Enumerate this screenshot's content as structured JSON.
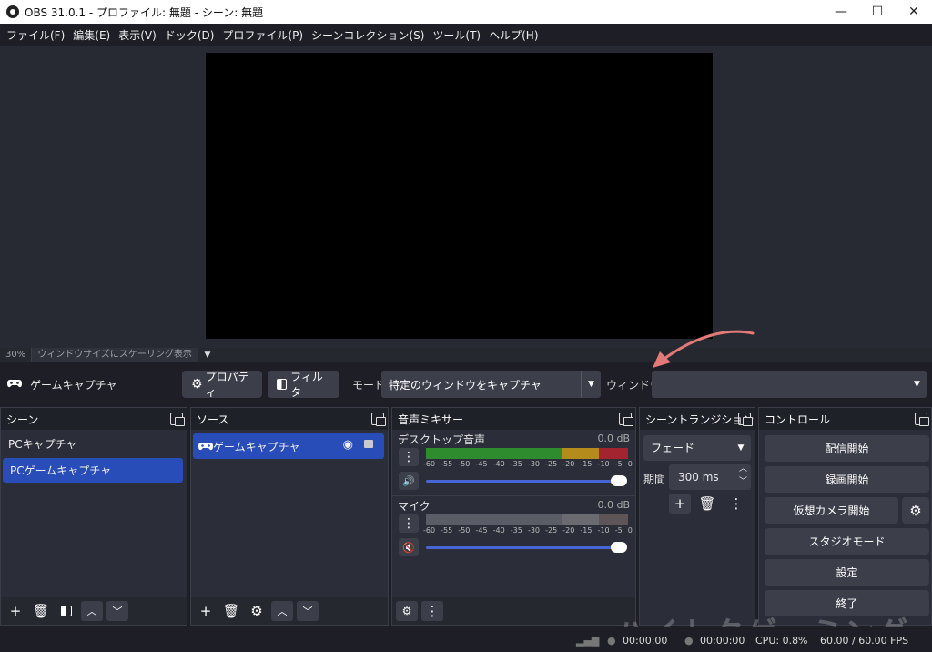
{
  "window": {
    "title": "OBS 31.0.1 - プロファイル: 無題 - シーン: 無題"
  },
  "menu": [
    "ファイル(F)",
    "編集(E)",
    "表示(V)",
    "ドック(D)",
    "プロファイル(P)",
    "シーンコレクション(S)",
    "ツール(T)",
    "ヘルプ(H)"
  ],
  "preview": {
    "zoom": "30%",
    "scaling_label": "ウィンドウサイズにスケーリング表示"
  },
  "context": {
    "source_name": "ゲームキャプチャ",
    "properties_label": "プロパティ",
    "filters_label": "フィルタ",
    "mode_label": "モード",
    "mode_value": "特定のウィンドウをキャプチャ",
    "window_label": "ウィンドウ",
    "window_value": ""
  },
  "docks": {
    "scenes": {
      "title": "シーン",
      "items": [
        "PCキャプチャ",
        "PCゲームキャプチャ"
      ],
      "selected_index": 1
    },
    "sources": {
      "title": "ソース",
      "items": [
        "ゲームキャプチャ"
      ]
    },
    "mixer": {
      "title": "音声ミキサー",
      "ticks": [
        "-60",
        "-55",
        "-50",
        "-45",
        "-40",
        "-35",
        "-30",
        "-25",
        "-20",
        "-15",
        "-10",
        "-5",
        "0"
      ],
      "channels": [
        {
          "name": "デスクトップ音声",
          "db": "0.0 dB",
          "muted": false
        },
        {
          "name": "マイク",
          "db": "0.0 dB",
          "muted": true
        }
      ]
    },
    "transitions": {
      "title": "シーントランジション",
      "type": "フェード",
      "duration_label": "期間",
      "duration_value": "300 ms"
    },
    "controls": {
      "title": "コントロール",
      "buttons": [
        "配信開始",
        "録画開始",
        "仮想カメラ開始",
        "スタジオモード",
        "設定",
        "終了"
      ]
    }
  },
  "status": {
    "stream_time": "00:00:00",
    "rec_time": "00:00:00",
    "cpu": "CPU: 0.8%",
    "fps": "60.00 / 60.00 FPS"
  },
  "watermark": "ハイトクゲーミング",
  "colors": {
    "accent": "#284cb8",
    "arrow": "#e37a78",
    "meter_green": "#2e8b2e",
    "meter_yellow": "#b58c1b",
    "meter_red": "#a3242f"
  },
  "icons": {
    "properties": "gear-icon",
    "filters": "filter-icon",
    "scene_source": "gamepad-icon",
    "eye": "eye-icon",
    "lock": "lock-icon",
    "add": "plus-icon",
    "remove": "trash-icon",
    "menu": "kebab-icon",
    "mute": "speaker-icon"
  }
}
